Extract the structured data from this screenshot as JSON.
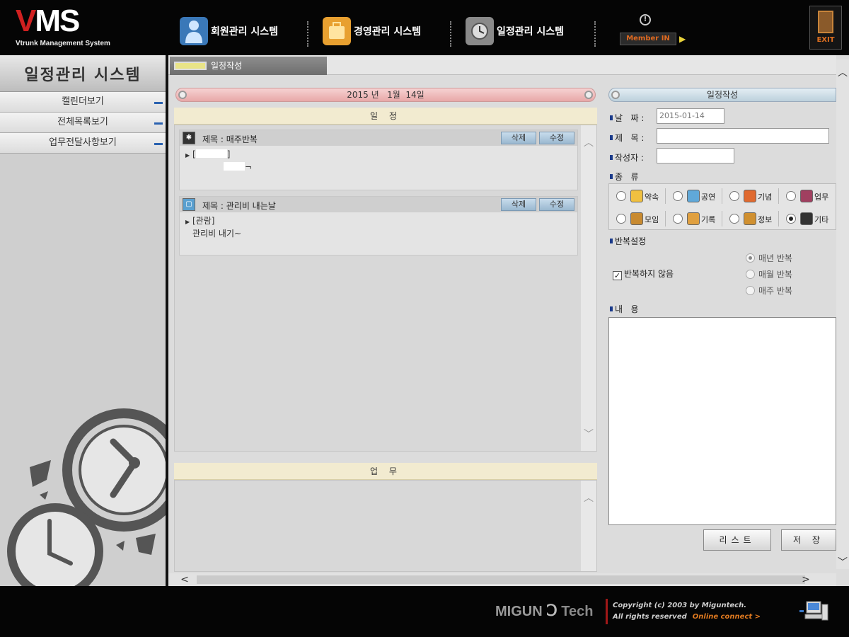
{
  "header": {
    "logo_mark": "VMS",
    "logo_sub": "Vtrunk Management System",
    "systems": [
      {
        "label": "회원관리 시스템",
        "icon": "member-management-icon"
      },
      {
        "label": "경영관리 시스템",
        "icon": "business-management-icon"
      },
      {
        "label": "일정관리 시스템",
        "icon": "schedule-management-icon"
      }
    ],
    "member_label": "Member IN",
    "exit_label": "EXIT"
  },
  "sidebar": {
    "title": "일정관리 시스템",
    "items": [
      {
        "label": "캘린더보기"
      },
      {
        "label": "전체목록보기"
      },
      {
        "label": "업무전달사항보기"
      }
    ]
  },
  "tab": {
    "label": "일정작성"
  },
  "schedule": {
    "date_header": "2015 년   1월  14일",
    "section_schedule": "일 정",
    "section_work": "업 무",
    "entries": [
      {
        "icon": "other-icon",
        "title": "제목 : 매주반복",
        "delete_label": "삭제",
        "edit_label": "수정",
        "tag": "[",
        "tag_end": "]",
        "content": "¬"
      },
      {
        "icon": "memo-icon",
        "title": "제목 : 관리비 내는날",
        "delete_label": "삭제",
        "edit_label": "수정",
        "tag": "[관람]",
        "content": "관리비 내기~"
      }
    ]
  },
  "form": {
    "header": "일정작성",
    "date_label": "날   짜 :",
    "date_value": "2015-01-14",
    "title_label": "제   목 :",
    "title_value": "",
    "author_label": "작성자 :",
    "author_value": "",
    "kind_label": "종   류",
    "kinds": [
      {
        "label": "약속",
        "icon": "appointment-icon",
        "color": "#f0c040",
        "selected": false
      },
      {
        "label": "공연",
        "icon": "performance-icon",
        "color": "#60a8d8",
        "selected": false
      },
      {
        "label": "기념",
        "icon": "anniversary-icon",
        "color": "#e06a30",
        "selected": false
      },
      {
        "label": "업무",
        "icon": "work-icon",
        "color": "#a04060",
        "selected": false
      },
      {
        "label": "모임",
        "icon": "meeting-icon",
        "color": "#c88a30",
        "selected": false
      },
      {
        "label": "기록",
        "icon": "record-icon",
        "color": "#e0a040",
        "selected": false
      },
      {
        "label": "정보",
        "icon": "info-icon",
        "color": "#d09030",
        "selected": false
      },
      {
        "label": "기타",
        "icon": "other-icon",
        "color": "#333333",
        "selected": true
      }
    ],
    "repeat_label": "반복설정",
    "no_repeat_label": "반복하지 않음",
    "no_repeat_checked": true,
    "repeat_options": [
      {
        "label": "매년 반복",
        "selected": true
      },
      {
        "label": "매월 반복",
        "selected": false
      },
      {
        "label": "매주 반복",
        "selected": false
      }
    ],
    "content_label": "내   용",
    "list_button": "리스트",
    "save_button": "저 장"
  },
  "footer": {
    "brand": "MIGUN",
    "brand_tech": "Tech",
    "copyright": "Copyright (c) 2003 by Miguntech.",
    "rights": "All rights reserved",
    "online_connect": "Online connect >"
  }
}
